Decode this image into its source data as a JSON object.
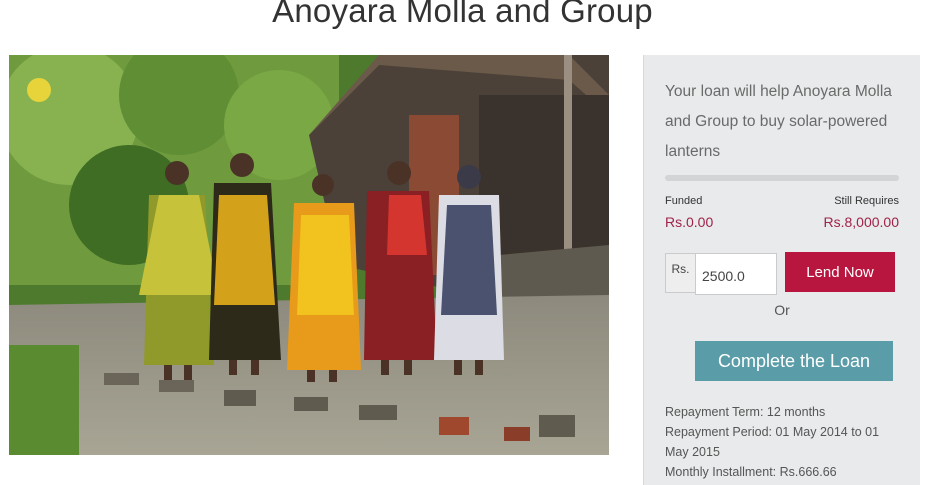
{
  "page": {
    "title": "Anoyara Molla and Group"
  },
  "loan": {
    "description": "Your loan will help Anoyara Molla and Group to buy solar-powered lanterns",
    "funded_label": "Funded",
    "funded_value": "Rs.0.00",
    "funded_fraction": 0,
    "requires_label": "Still Requires",
    "requires_value": "Rs.8,000.00",
    "currency_prefix": "Rs.",
    "amount_value": "2500.0",
    "lend_label": "Lend Now",
    "or_label": "Or",
    "complete_label": "Complete the Loan",
    "repayment_term": "Repayment Term: 12 months",
    "repayment_period": "Repayment Period: 01 May 2014 to 01 May 2015",
    "monthly_installment": "Monthly Installment: Rs.666.66"
  },
  "colors": {
    "brand": "#b8163f",
    "accent": "#5a9da8",
    "panel_bg": "#e8eaeb"
  }
}
